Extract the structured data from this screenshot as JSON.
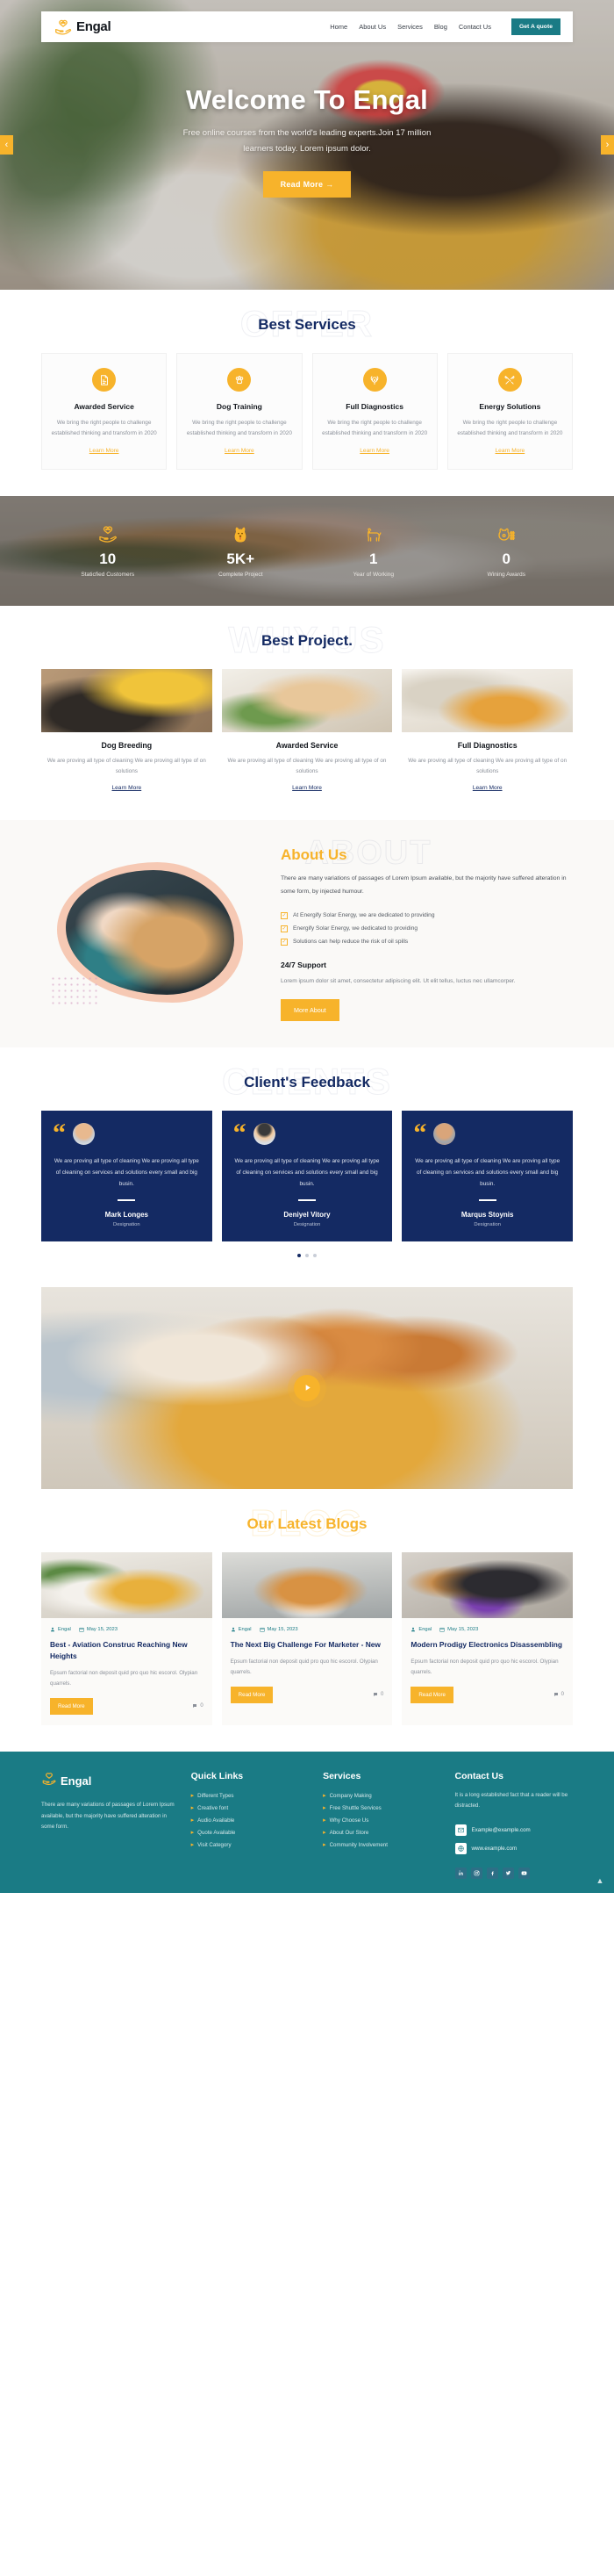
{
  "nav": {
    "brand": "Engal",
    "brand_logo_icon": "hand-heart-paw-logo",
    "links": [
      {
        "label": "Home"
      },
      {
        "label": "About Us"
      },
      {
        "label": "Services"
      },
      {
        "label": "Blog"
      },
      {
        "label": "Contact Us"
      }
    ],
    "cta": "Get A quote",
    "cta_color": "#1a7b85"
  },
  "hero": {
    "title": "Welcome To Engal",
    "subtitle_line1": "Free online courses from the world's leading experts.Join 17 million",
    "subtitle_line2": "learners today. Lorem ipsum dolor.",
    "button": "Read More",
    "prev_icon": "chevron-left-icon",
    "next_icon": "chevron-right-icon"
  },
  "services": {
    "watermark": "OFFER",
    "title": "Best Services",
    "learn_more": "Learn More",
    "cards": [
      {
        "icon": "document-report-icon",
        "name": "Awarded Service",
        "desc": "We bring the right people to challenge established thinking and transform in 2020"
      },
      {
        "icon": "paw-icon",
        "name": "Dog Training",
        "desc": "We bring the right people to challenge established thinking and transform in 2020"
      },
      {
        "icon": "dog-head-icon",
        "name": "Full Diagnostics",
        "desc": "We bring the right people to challenge established thinking and transform in 2020"
      },
      {
        "icon": "tools-icon",
        "name": "Energy Solutions",
        "desc": "We bring the right people to challenge established thinking and transform in 2020"
      }
    ]
  },
  "counters": [
    {
      "icon": "hand-heart-paw-icon",
      "value": "10",
      "label": "Staticfied Customers"
    },
    {
      "icon": "dog-sitting-icon",
      "value": "5K+",
      "label": "Complete Project"
    },
    {
      "icon": "dog-standing-icon",
      "value": "1",
      "label": "Year of Working"
    },
    {
      "icon": "dog-grooming-icon",
      "value": "0",
      "label": "Wining Awards"
    }
  ],
  "projects": {
    "watermark": "WHY US",
    "title": "Best Project.",
    "learn_more": "Learn More",
    "cards": [
      {
        "name": "Dog Breeding",
        "desc": "We are proving all type of cleaning We are proving all type of on solutions"
      },
      {
        "name": "Awarded Service",
        "desc": "We are proving all type of cleaning We are proving all type of on solutions"
      },
      {
        "name": "Full Diagnostics",
        "desc": "We are proving all type of cleaning We are proving all type of on solutions"
      }
    ]
  },
  "about": {
    "watermark": "ABOUT",
    "title": "About Us",
    "paragraph": "There are many variations of passages of Lorem Ipsum available, but the majority have suffered alteration in some form, by injected humour.",
    "bullets": [
      "At Energify Solar Energy, we are dedicated to providing",
      "Energify Solar Energy, we dedicated to providing",
      "Solutions can help reduce the risk of oil spills"
    ],
    "subheading": "24/7 Support",
    "note": "Lorem ipsum dolor sit amet, consectetur adipiscing elit. Ut elit tellus, luctus nec ullamcorper.",
    "button": "More About"
  },
  "testimonials": {
    "watermark": "CLIENTS",
    "title": "Client's Feedback",
    "quote_icon": "quote-icon",
    "cards": [
      {
        "text": "We are proving all type of cleaning We are proving all type of cleaning on services and solutions every small and big busin.",
        "name": "Mark Longes",
        "role": "Designation"
      },
      {
        "text": "We are proving all type of cleaning We are proving all type of cleaning on services and solutions every small and big busin.",
        "name": "Deniyel Vitory",
        "role": "Designation"
      },
      {
        "text": "We are proving all type of cleaning We are proving all type of cleaning on services and solutions every small and big busin.",
        "name": "Marqus Stoynis",
        "role": "Designation"
      }
    ],
    "dots": 3,
    "active_dot": 0
  },
  "banner": {
    "play_icon": "play-icon"
  },
  "blog": {
    "watermark": "BLOG",
    "title": "Our Latest Blogs",
    "read_more": "Read More",
    "cards": [
      {
        "author": "Engal",
        "date": "May 15, 2023",
        "title": "Best - Aviation Construc Reaching New Heights",
        "desc": "Epsum factorial non deposit quid pro quo hic escorol. Olypian quarrels.",
        "comments": "0"
      },
      {
        "author": "Engal",
        "date": "May 15, 2023",
        "title": "The Next Big Challenge For Marketer - New",
        "desc": "Epsum factorial non deposit quid pro quo hic escorol. Olypian quarrels.",
        "comments": "0"
      },
      {
        "author": "Engal",
        "date": "May 15, 2023",
        "title": "Modern Prodigy Electronics Disassembling",
        "desc": "Epsum factorial non deposit quid pro quo hic escorol. Olypian quarrels.",
        "comments": "0"
      }
    ]
  },
  "footer": {
    "brand": "Engal",
    "about": "There are many variations of passages of Lorem Ipsum available, but the majority have suffered alteration in some form.",
    "quick_links_title": "Quick Links",
    "quick_links": [
      {
        "label": "Different Types"
      },
      {
        "label": "Creative font"
      },
      {
        "label": "Audio Available"
      },
      {
        "label": "Quote Available"
      },
      {
        "label": "Visit Category"
      }
    ],
    "services_title": "Services",
    "services": [
      {
        "label": "Company Making"
      },
      {
        "label": "Free Shuttle Services"
      },
      {
        "label": "Why Choose Us"
      },
      {
        "label": "About Our Store"
      },
      {
        "label": "Community Involvement"
      }
    ],
    "contact_title": "Contact Us",
    "contact_text": "It is a long established fact that a reader will be distracted.",
    "email": "Example@example.com",
    "website": "www.example.com",
    "email_icon": "mail-icon",
    "website_icon": "globe-icon",
    "socials": [
      {
        "name": "linkedin-icon"
      },
      {
        "name": "instagram-icon"
      },
      {
        "name": "facebook-icon"
      },
      {
        "name": "twitter-icon"
      },
      {
        "name": "youtube-icon"
      }
    ],
    "to_top_icon": "chevron-up-icon"
  }
}
